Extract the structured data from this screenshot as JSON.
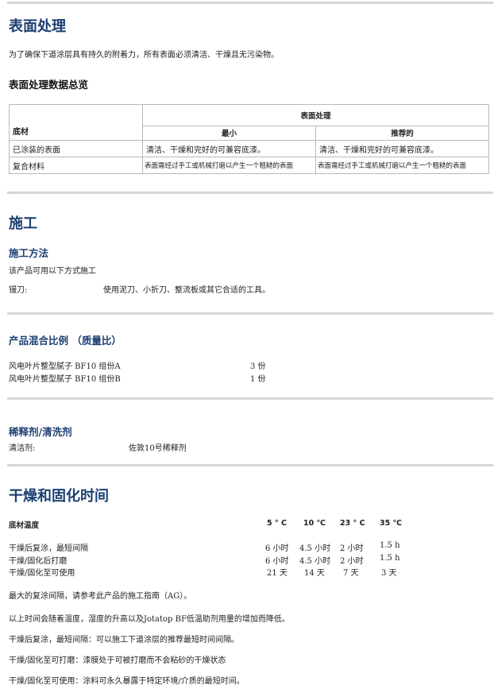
{
  "surface": {
    "title": "表面处理",
    "intro": "为了确保下道涂层具有持久的附着力，所有表面必须清洁、干燥且无污染物。",
    "overview_title": "表面处理数据总览",
    "table": {
      "group_header": "表面处理",
      "col_substrate": "底材",
      "col_min": "最小",
      "col_rec": "推荐的",
      "rows": [
        {
          "substrate": "已涂装的表面",
          "min": "清洁、干燥和完好的可兼容底漆。",
          "rec": "清洁、干燥和完好的可兼容底漆。"
        },
        {
          "substrate": "复合材料",
          "min": "表面需经过手工或机械打磨以产生一个粗糙的表面",
          "rec": "表面需经过手工或机械打磨以产生一个粗糙的表面"
        }
      ]
    }
  },
  "application": {
    "title": "施工",
    "method_title": "施工方法",
    "method_intro": "该产品可用以下方式施工",
    "tool_label": "镘刀:",
    "tool_value": "使用泥刀、小折刀、整流板或其它合适的工具。"
  },
  "mix": {
    "title": "产品混合比例 （质量比）",
    "rows": [
      {
        "name": "风电叶片整型腻子 BF10 组份A",
        "value": "3 份"
      },
      {
        "name": "风电叶片整型腻子 BF10 组份B",
        "value": "1 份"
      }
    ]
  },
  "thinner": {
    "title": "稀释剂/清洗剂",
    "label": "清洁剂:",
    "value": "佐敦10号稀释剂"
  },
  "drying": {
    "title": "干燥和固化时间",
    "header_label": "底材温度",
    "temps": [
      "5 ° C",
      "10 ℃",
      "23 ° C",
      "35 ℃"
    ],
    "rows": [
      {
        "label": "干燥后复涂，最短间隔",
        "values": [
          "6 小时",
          "4.5 小时",
          "2 小时",
          "1.5 h"
        ]
      },
      {
        "label": "干燥/固化后打磨",
        "values": [
          "6 小时",
          "4.5 小时",
          "2 小时",
          "1.5 h"
        ]
      },
      {
        "label": "干燥/固化至可使用",
        "values": [
          "21 天",
          "14 天",
          "7 天",
          "3 天"
        ]
      }
    ],
    "notes": [
      "最大的复涂间隔，请参考此产品的施工指南（AG）。",
      "以上时间会随着温度，湿度的升高以及Jotatop BF低温助剂用量的增加而降低。",
      "干燥后复涂，最短间隔：可以施工下道涂层的推荐最短时间间隔。",
      "干燥/固化至可打磨：漆膜处于可被打磨而不会粘砂的干燥状态",
      "干燥/固化至可使用：涂料可永久暴露于特定环境/介质的最短时间。"
    ]
  }
}
